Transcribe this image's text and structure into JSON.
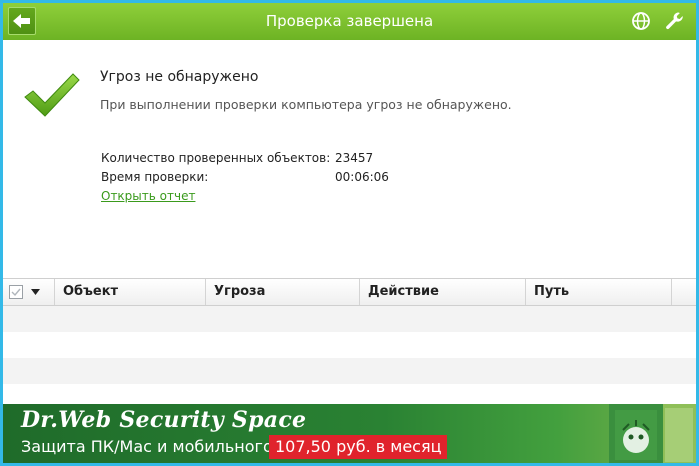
{
  "window": {
    "title": "Проверка завершена"
  },
  "toolbar": {
    "icons": [
      "back-arrow-icon",
      "globe-icon",
      "wrench-icon"
    ]
  },
  "result": {
    "title": "Угроз не обнаружено",
    "description": "При выполнении проверки компьютера угроз не обнаружено."
  },
  "stats": {
    "objects_label": "Количество проверенных объектов:",
    "objects_value": "23457",
    "time_label": "Время проверки:",
    "time_value": "00:06:06",
    "report_link": "Открыть отчет"
  },
  "table": {
    "columns": [
      "Объект",
      "Угроза",
      "Действие",
      "Путь"
    ]
  },
  "banner": {
    "title": "Dr.Web Security Space",
    "subtitle": "Защита ПК/Mac и мобильного",
    "price": "107,50 руб. в месяц"
  },
  "colors": {
    "accent_green": "#6db324",
    "frame_blue": "#33b9e8",
    "link_green": "#3a9a1c",
    "price_red": "#e0232c"
  }
}
